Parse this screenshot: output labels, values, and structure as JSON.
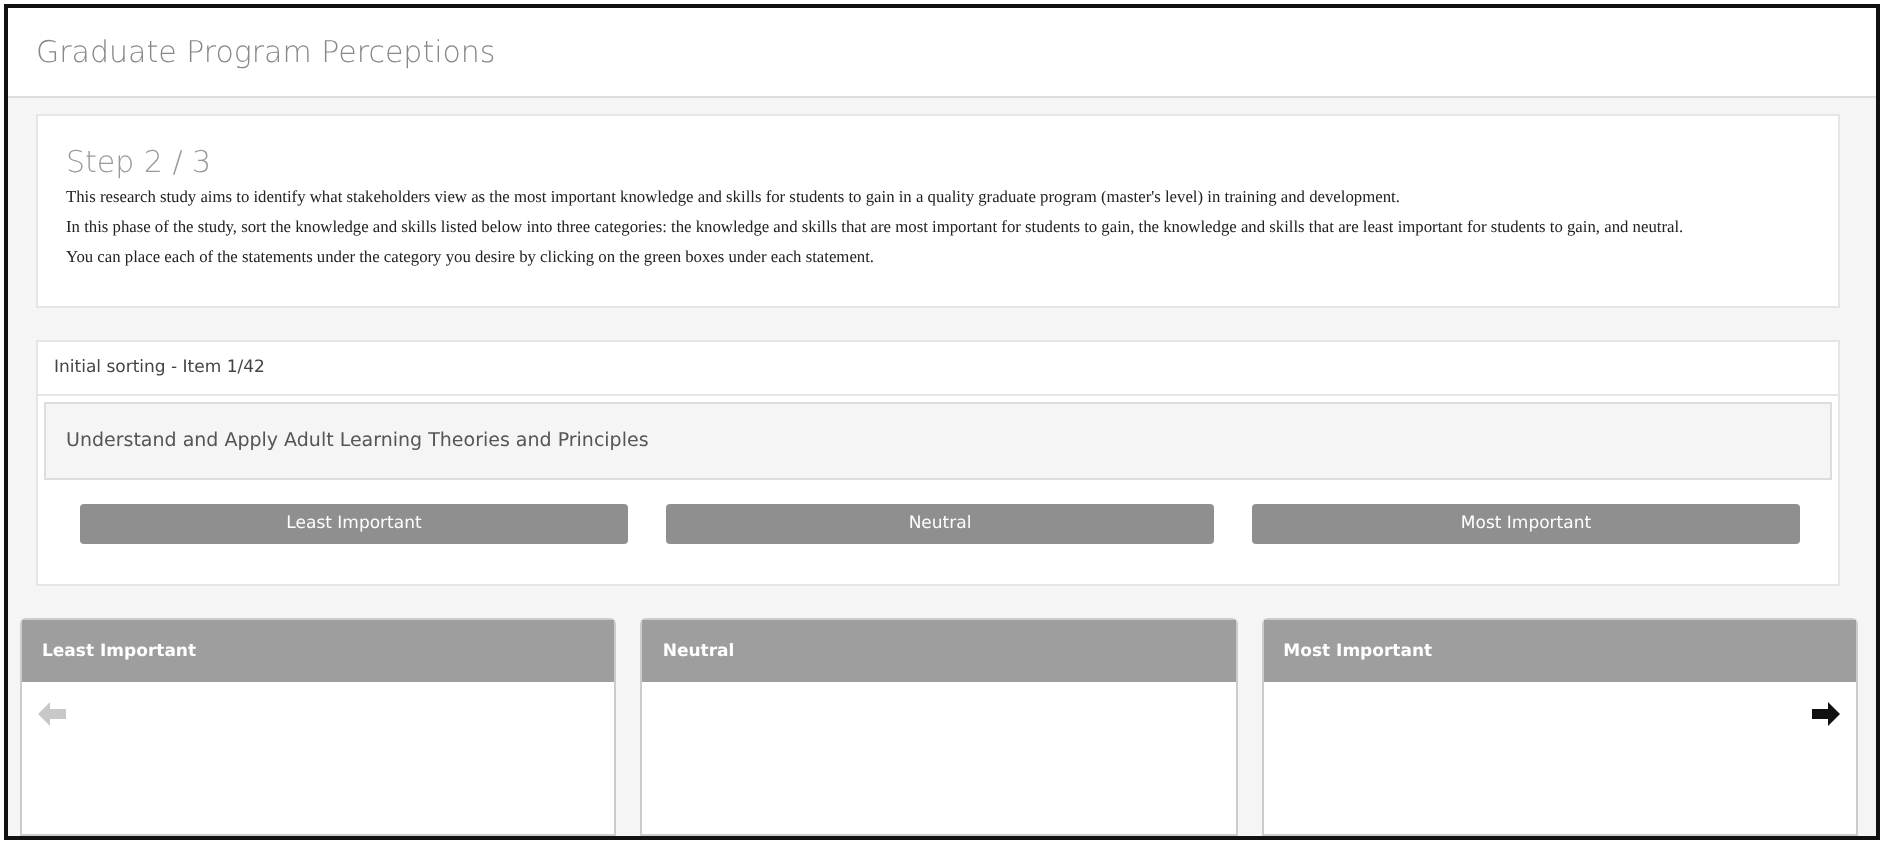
{
  "window": {
    "title": "Graduate Program Perceptions"
  },
  "step": {
    "title": "Step 2 / 3",
    "paragraphs": [
      "This research study aims to identify what stakeholders view as the most important knowledge and skills for students to gain in a quality graduate program (master's level) in training and development.",
      "In this phase of the study, sort the knowledge and skills listed below into three categories: the knowledge and skills that are most important for students to gain, the knowledge and skills that are least important for students to gain, and neutral.",
      "You can place each of the statements under the category you desire by clicking on the green boxes under each statement."
    ]
  },
  "sorting": {
    "header": "Initial sorting - Item 1/42",
    "statement": "Understand and Apply Adult Learning Theories and Principles",
    "buttons": [
      "Least Important",
      "Neutral",
      "Most Important"
    ]
  },
  "columns": [
    {
      "title": "Least Important",
      "arrow": {
        "kind": "back",
        "disabled": true
      }
    },
    {
      "title": "Neutral"
    },
    {
      "title": "Most Important",
      "arrow": {
        "kind": "next",
        "disabled": false
      }
    }
  ]
}
